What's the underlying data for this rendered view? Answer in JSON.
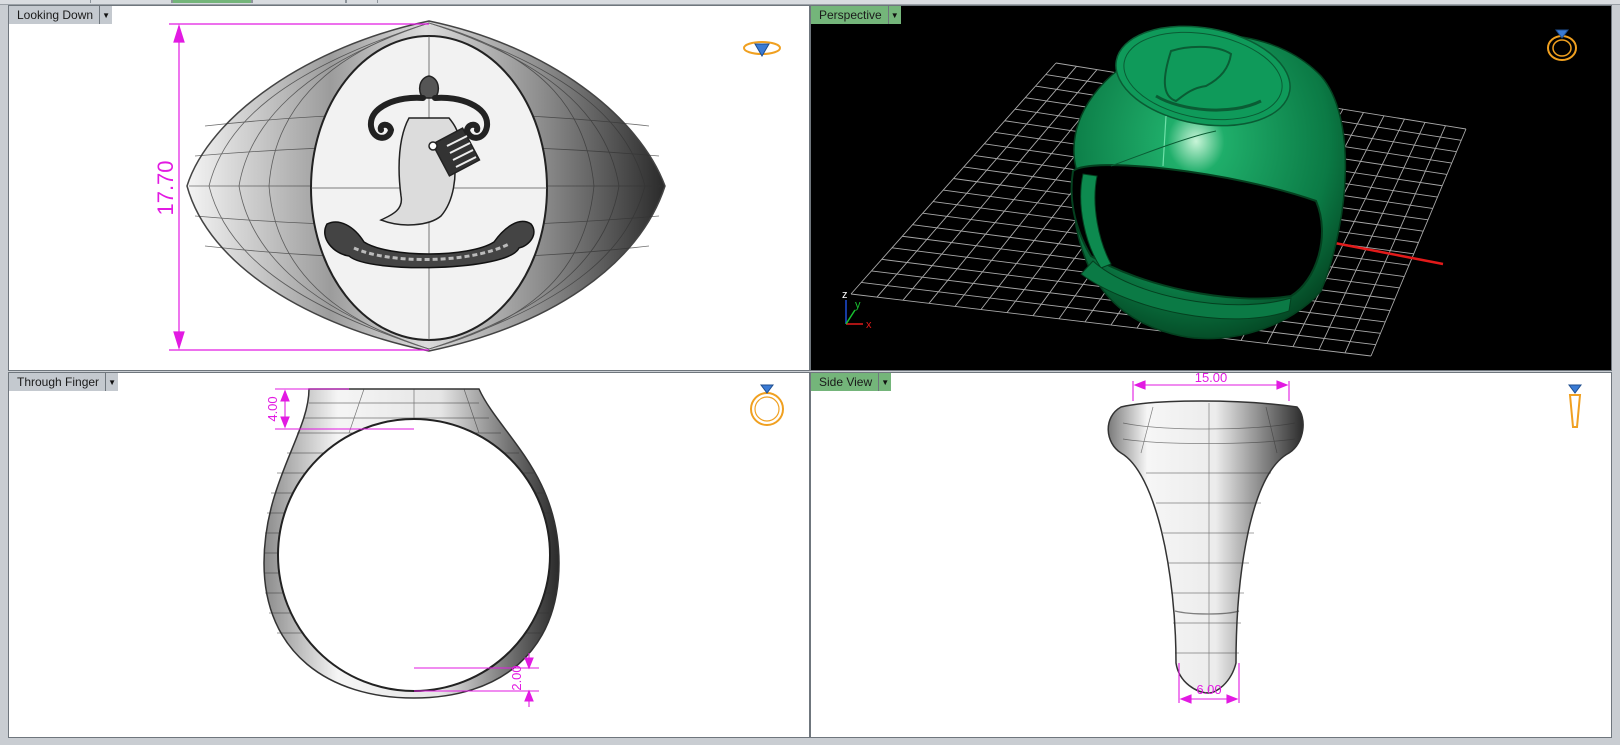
{
  "viewports": {
    "top_left": {
      "label": "Looking Down",
      "dimension": "17.70"
    },
    "top_right": {
      "label": "Perspective",
      "axis_x": "x",
      "axis_y": "y",
      "axis_z": "z"
    },
    "bottom_left": {
      "label": "Through Finger",
      "dim_top": "4.00",
      "dim_bottom": "2.00"
    },
    "bottom_right": {
      "label": "Side View",
      "dim_top": "15.00",
      "dim_bottom": "6.00"
    }
  },
  "icons": {
    "view_cube_top": "ring-top-view-icon",
    "view_cube_perspective": "ring-perspective-icon",
    "view_cube_front": "ring-front-view-icon",
    "view_cube_side": "ring-side-view-icon",
    "dropdown": "dropdown-arrow-icon"
  },
  "colors": {
    "dimension": "#e21ae2",
    "label_active": "#74b57a",
    "label_inactive": "#c4c9cf",
    "model_green": "#0e8f55",
    "grid": "#a8a8a8",
    "icon_gold": "#f0a020",
    "icon_blue": "#3a7bd5"
  }
}
